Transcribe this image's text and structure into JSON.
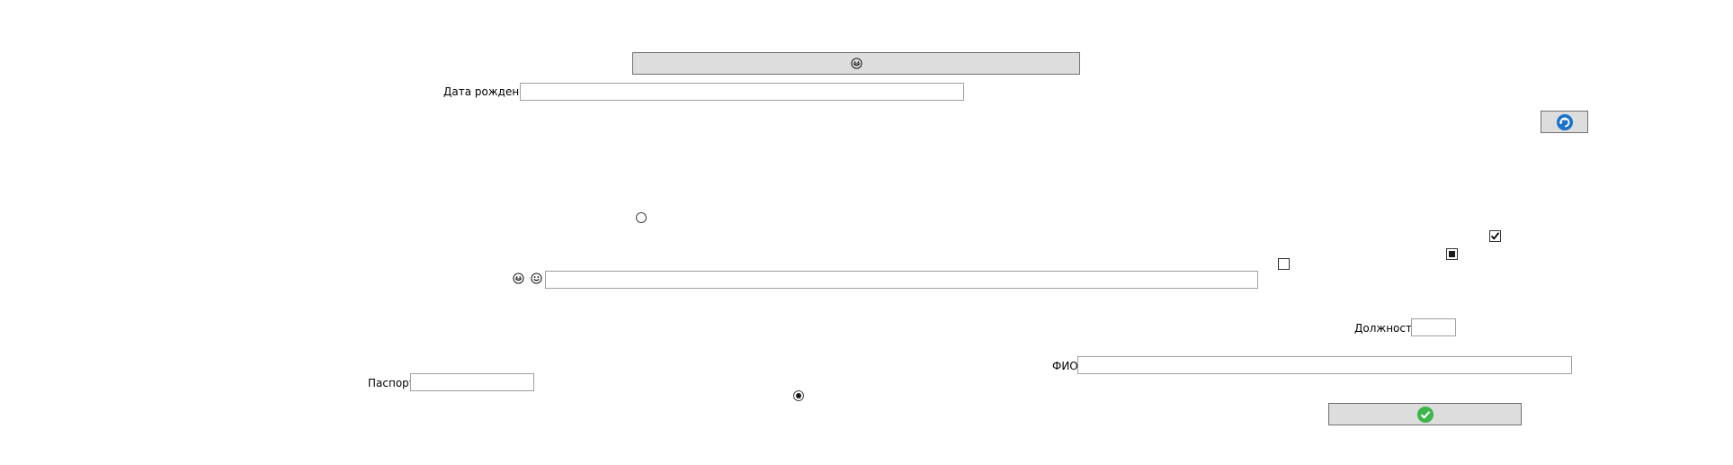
{
  "form": {
    "birth_date_label": "Дата рождения",
    "birth_date_value": "",
    "position_label": "Должность",
    "position_value": "",
    "full_name_label": "ФИО",
    "full_name_value": "",
    "passport_label": "Паспорт",
    "passport_value": "",
    "middle_field_value": ""
  },
  "icons": {
    "top_button_icon": "grinning-face-icon",
    "refresh_button_icon": "refresh-icon",
    "left_emoji_1": "grinning-face-icon",
    "left_emoji_2": "smiling-face-icon",
    "confirm_button_icon": "checkmark-icon"
  },
  "controls": {
    "checkbox_top_checked": true,
    "checkbox_mid_indeterminate": true,
    "checkbox_empty_checked": false,
    "radio_top_selected": false,
    "radio_bottom_selected": true
  },
  "colors": {
    "refresh_blue": "#1a73c8",
    "confirm_green": "#3cb54a",
    "button_bg": "#dddddd",
    "field_border": "#a0a0a0"
  }
}
